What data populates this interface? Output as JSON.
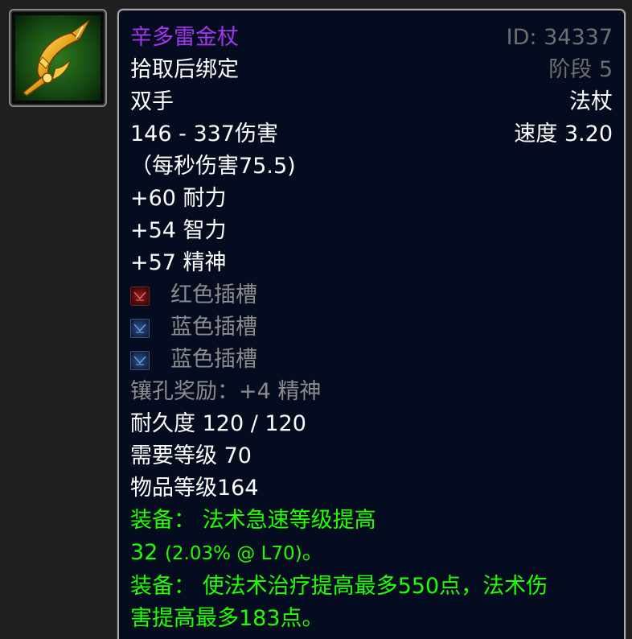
{
  "item": {
    "icon": "golden-staff-icon",
    "name": "辛多雷金杖",
    "id_text": "ID: 34337",
    "binding": "拾取后绑定",
    "tier_text": "阶段 5",
    "slot": "双手",
    "type": "法杖",
    "damage": "146 - 337伤害",
    "speed": "速度 3.20",
    "dps": "（每秒伤害75.5)",
    "stats": [
      "+60 耐力",
      "+54 智力",
      "+57 精神"
    ],
    "sockets": [
      {
        "color": "red",
        "label": "红色插槽"
      },
      {
        "color": "blue",
        "label": "蓝色插槽"
      },
      {
        "color": "blue",
        "label": "蓝色插槽"
      }
    ],
    "socket_bonus": "镶孔奖励：+4 精神",
    "durability": "耐久度 120 / 120",
    "required_level": "需要等级 70",
    "item_level": "物品等级164",
    "equip": [
      {
        "line1": "装备： 法术急速等级提高",
        "line2_value": "32",
        "line2_detail": "(2.03% @ L70)",
        "line2_end": "。"
      },
      {
        "line1": "装备： 使法术治疗提高最多550点，法术伤",
        "line2": "害提高最多183点。"
      }
    ]
  },
  "colors": {
    "epic_purple": "#a335ee",
    "white": "#ffffff",
    "gray": "#8c8c8c",
    "green": "#1eff00",
    "tooltip_bg": "#050c1f",
    "border": "#a9a9a9"
  }
}
